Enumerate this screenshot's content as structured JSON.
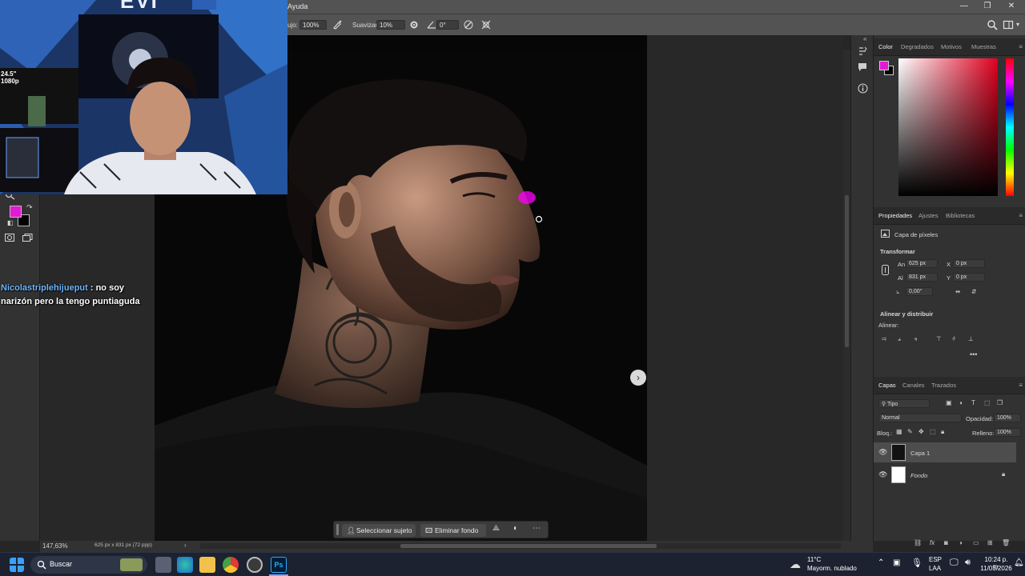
{
  "menu": {
    "help_label": "Ayuda"
  },
  "options_bar": {
    "flow_label": "ujo:",
    "flow_value": "100%",
    "smoothing_label": "Suavizar:",
    "smoothing_value": "10%",
    "angle_value": "0°"
  },
  "chat": {
    "user": "Nicolastriplehijueput",
    "message": ": no soy narizón pero la tengo puntiaguda"
  },
  "webcam": {
    "monitor_text": "24.5\"\n1080p",
    "banner_text": "EVI"
  },
  "colors": {
    "foreground": "#e11bd3",
    "background": "#000000",
    "accent": "#ff00ff"
  },
  "color_panel": {
    "tabs": [
      "Color",
      "Degradados",
      "Motivos",
      "Muestras"
    ],
    "active_tab": "Color"
  },
  "properties_panel": {
    "tabs": [
      "Propiedades",
      "Ajustes",
      "Bibliotecas"
    ],
    "layer_type": "Capa de píxeles",
    "transform_title": "Transformar",
    "w_label": "An",
    "w_value": "625 px",
    "h_label": "Al",
    "h_value": "831 px",
    "x_label": "X",
    "x_value": "0 px",
    "y_label": "Y",
    "y_value": "0 px",
    "angle_value": "0,00°",
    "align_title": "Alinear y distribuir",
    "align_label": "Alinear:"
  },
  "layers_panel": {
    "tabs": [
      "Capas",
      "Canales",
      "Trazados"
    ],
    "filter_label": "Tipo",
    "blend_mode": "Normal",
    "opacity_label": "Opacidad:",
    "opacity_value": "100%",
    "lock_label": "Bloq.:",
    "fill_label": "Relleno:",
    "fill_value": "100%",
    "layers": [
      {
        "name": "Capa 1",
        "selected": true
      },
      {
        "name": "Fondo",
        "selected": false
      }
    ]
  },
  "status_bar": {
    "zoom": "147,63%",
    "doc_info": "625 px x 831 px (72 ppp)"
  },
  "context_bar": {
    "select_subject": "Seleccionar sujeto",
    "remove_bg": "Eliminar fondo"
  },
  "taskbar": {
    "search_placeholder": "Buscar",
    "weather_temp": "11°C",
    "weather_desc": "Mayorm. nublado",
    "lang_top": "ESP",
    "lang_bottom": "LAA",
    "time": "10:24 p. m.",
    "date": "11/03/2026"
  }
}
